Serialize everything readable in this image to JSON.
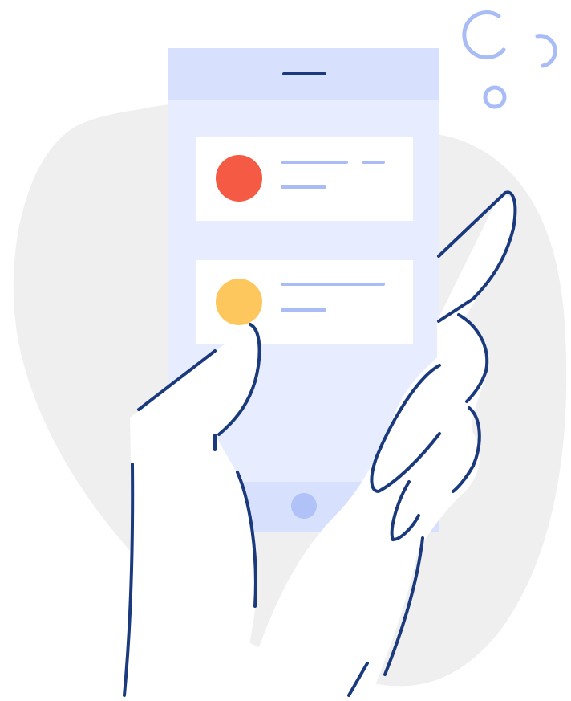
{
  "illustration": {
    "colors": {
      "blob": "#efefef",
      "phone_frame": "#d7e0fd",
      "phone_screen": "#e7edfe",
      "card": "#ffffff",
      "text_line": "#a9bcf6",
      "avatar_red": "#f55a45",
      "avatar_yellow": "#fdc75e",
      "home_button": "#b0c2f7",
      "stroke": "#1b3a7d",
      "bubble": "#a9bcf6",
      "hand_fill": "#ffffff"
    },
    "cards": [
      {
        "avatar": "avatar_red"
      },
      {
        "avatar": "avatar_yellow"
      }
    ],
    "bubble_icon": "bubble-circles",
    "hand_icon": "hand-holding-phone"
  }
}
